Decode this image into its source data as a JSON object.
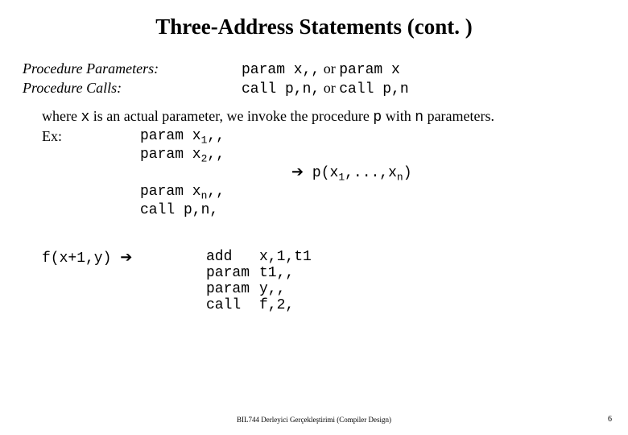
{
  "title": "Three-Address Statements (cont. )",
  "def": {
    "params_label": "Procedure Parameters:",
    "params_code": "param x,,",
    "params_or": "  or  ",
    "params_code2": "param x",
    "calls_label": "Procedure Calls:",
    "calls_code": "call p,n,",
    "calls_or": "  or  ",
    "calls_code2": "call p,n"
  },
  "desc": {
    "pre": "where ",
    "x": "x",
    "mid1": " is an actual parameter, we invoke the procedure ",
    "p": "p",
    "mid2": " with ",
    "n": "n",
    "post": " parameters."
  },
  "ex_label": "Ex:",
  "ex": {
    "l1a": "param x",
    "l1sub": "1",
    "l1b": ",,",
    "l2a": "param x",
    "l2sub": "2",
    "l2b": ",,",
    "arrow": "➔",
    "call_a": "  p(x",
    "call_s1": "1",
    "call_mid": ",...,x",
    "call_s2": "n",
    "call_end": ")",
    "l3a": "param x",
    "l3sub": "n",
    "l3b": ",,",
    "l4a": "call  p,n,"
  },
  "b2": {
    "lhs": "f(x+1,y)  ",
    "arrow": "➔",
    "r1op": "add",
    "r1arg": "x,1,t1",
    "r2op": "param",
    "r2arg": "t1,,",
    "r3op": "param",
    "r3arg": "y,,",
    "r4op": "call",
    "r4arg": "f,2,"
  },
  "footer": "BIL744 Derleyici Gerçekleştirimi (Compiler Design)",
  "pagenum": "6"
}
